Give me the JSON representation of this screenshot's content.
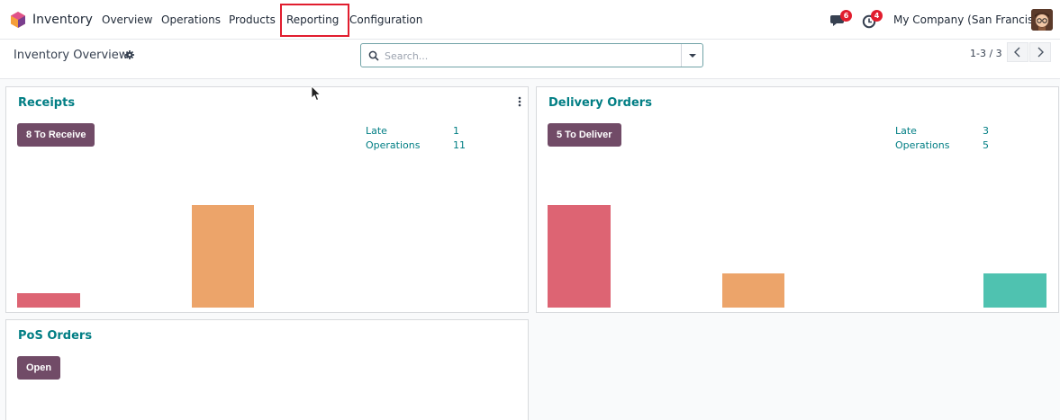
{
  "app": {
    "name": "Inventory"
  },
  "menu": [
    {
      "label": "Overview"
    },
    {
      "label": "Operations"
    },
    {
      "label": "Products"
    },
    {
      "label": "Reporting"
    },
    {
      "label": "Configuration"
    }
  ],
  "systray": {
    "messages_count": "6",
    "activities_count": "4",
    "company": "My Company (San Francisco)"
  },
  "breadcrumb": {
    "title": "Inventory Overview"
  },
  "search": {
    "placeholder": "Search..."
  },
  "pager": {
    "value": "1-3 / 3"
  },
  "colors": {
    "primary": "#714b67",
    "link": "#017e84",
    "bar_late": "#dd6473",
    "bar_today": "#eca46a",
    "bar_future": "#4fc2b0",
    "highlight": "#e11d2e"
  },
  "cards": [
    {
      "title": "Receipts",
      "button": "8 To Receive",
      "stats": [
        {
          "label": "Late",
          "value": "1"
        },
        {
          "label": "Operations",
          "value": "11"
        }
      ],
      "bars": [
        {
          "color": "bar_late",
          "level": 0.14
        },
        {
          "color": "bar_today",
          "level": 1.0
        }
      ]
    },
    {
      "title": "Delivery Orders",
      "button": "5 To Deliver",
      "stats": [
        {
          "label": "Late",
          "value": "3"
        },
        {
          "label": "Operations",
          "value": "5"
        }
      ],
      "bars": [
        {
          "color": "bar_late",
          "level": 1.0
        },
        {
          "color": "bar_today",
          "level": 0.33
        },
        {
          "color": "bar_future",
          "level": 0.33
        }
      ]
    },
    {
      "title": "PoS Orders",
      "button": "Open"
    }
  ]
}
